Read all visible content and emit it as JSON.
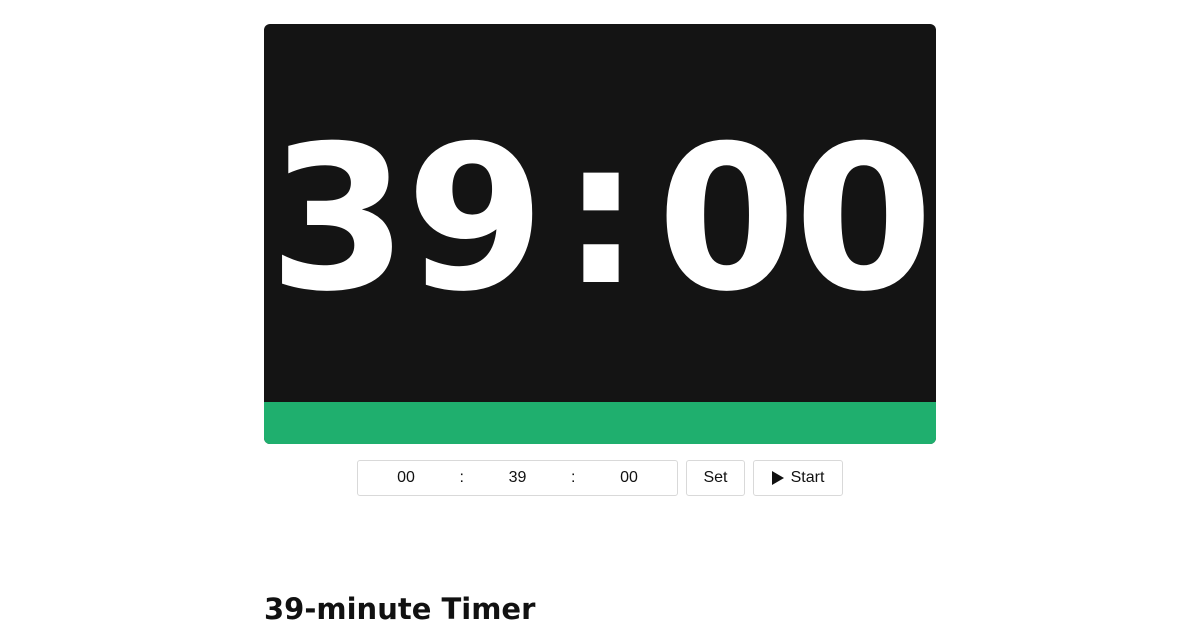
{
  "timer_display": {
    "minutes": "39",
    "separator": ":",
    "seconds": "00"
  },
  "progress": {
    "fraction": 1.0,
    "color": "#1faf6e"
  },
  "panel": {
    "background": "#141414"
  },
  "time_input": {
    "hours": "00",
    "minutes": "39",
    "seconds": "00",
    "separator": ":"
  },
  "buttons": {
    "set_label": "Set",
    "start_label": "Start",
    "start_icon": "play-icon"
  },
  "heading": "39-minute Timer"
}
